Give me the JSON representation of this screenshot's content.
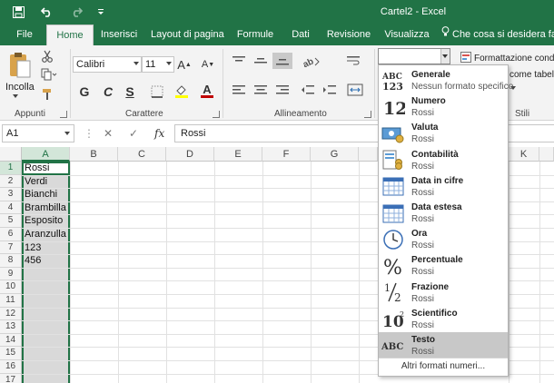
{
  "window": {
    "title": "Cartel2 - Excel",
    "qat": {
      "save_icon": "save-icon",
      "undo_icon": "undo-icon",
      "redo_icon": "redo-icon",
      "customize_icon": "customize-qat-icon"
    }
  },
  "tabs": [
    {
      "label": "File",
      "active": false
    },
    {
      "label": "Home",
      "active": true
    },
    {
      "label": "Inserisci",
      "active": false
    },
    {
      "label": "Layout di pagina",
      "active": false
    },
    {
      "label": "Formule",
      "active": false
    },
    {
      "label": "Dati",
      "active": false
    },
    {
      "label": "Revisione",
      "active": false
    },
    {
      "label": "Visualizza",
      "active": false
    }
  ],
  "tellme": {
    "label": "Che cosa si desidera fare?"
  },
  "ribbon": {
    "clipboard": {
      "paste_label": "Incolla",
      "group_label": "Appunti"
    },
    "font": {
      "name": "Calibri",
      "size": "11",
      "bold": "G",
      "italic": "C",
      "underline": "S",
      "grow": "A",
      "shrink": "A",
      "font_color": "A",
      "group_label": "Carattere",
      "font_color_hex": "#c00000",
      "fill_color_hex": "#ffff00"
    },
    "alignment": {
      "group_label": "Allineamento"
    },
    "styles": {
      "conditional_formatting": "Formattazione condiz",
      "format_as_table": "come tabell",
      "group_label": "Stili"
    }
  },
  "formula_bar": {
    "name_box": "A1",
    "fx": "fx",
    "value": "Rossi"
  },
  "grid": {
    "columns": [
      "A",
      "B",
      "C",
      "D",
      "E",
      "F",
      "G",
      "K"
    ],
    "rows": [
      "1",
      "2",
      "3",
      "4",
      "5",
      "6",
      "7",
      "8",
      "9",
      "10",
      "11",
      "12",
      "13",
      "14",
      "15",
      "16",
      "17"
    ],
    "cells_a": [
      "Rossi",
      "Verdi",
      "Bianchi",
      "Brambilla",
      "Esposito",
      "Aranzulla",
      "123",
      "456"
    ]
  },
  "number_format_menu": {
    "items": [
      {
        "title": "Generale",
        "sub": "Nessun formato specifico",
        "icon": "general-format-icon",
        "glyph": "ABC\n123"
      },
      {
        "title": "Numero",
        "sub": "Rossi",
        "icon": "number-format-icon",
        "glyph": "12"
      },
      {
        "title": "Valuta",
        "sub": "Rossi",
        "icon": "currency-format-icon",
        "glyph": ""
      },
      {
        "title": "Contabilità",
        "sub": "Rossi",
        "icon": "accounting-format-icon",
        "glyph": ""
      },
      {
        "title": "Data in cifre",
        "sub": "Rossi",
        "icon": "short-date-icon",
        "glyph": ""
      },
      {
        "title": "Data estesa",
        "sub": "Rossi",
        "icon": "long-date-icon",
        "glyph": ""
      },
      {
        "title": "Ora",
        "sub": "Rossi",
        "icon": "clock-icon",
        "glyph": ""
      },
      {
        "title": "Percentuale",
        "sub": "Rossi",
        "icon": "percent-icon",
        "glyph": "%"
      },
      {
        "title": "Frazione",
        "sub": "Rossi",
        "icon": "fraction-icon",
        "glyph": "½"
      },
      {
        "title": "Scientifico",
        "sub": "Rossi",
        "icon": "scientific-icon",
        "glyph": "10²"
      },
      {
        "title": "Testo",
        "sub": "Rossi",
        "icon": "text-format-icon",
        "glyph": "ABC",
        "highlighted": true
      }
    ],
    "more": "Altri formati numeri..."
  },
  "colors": {
    "accent": "#217346",
    "selection": "#d9d9d9",
    "highlight": "#c8c8c8"
  }
}
